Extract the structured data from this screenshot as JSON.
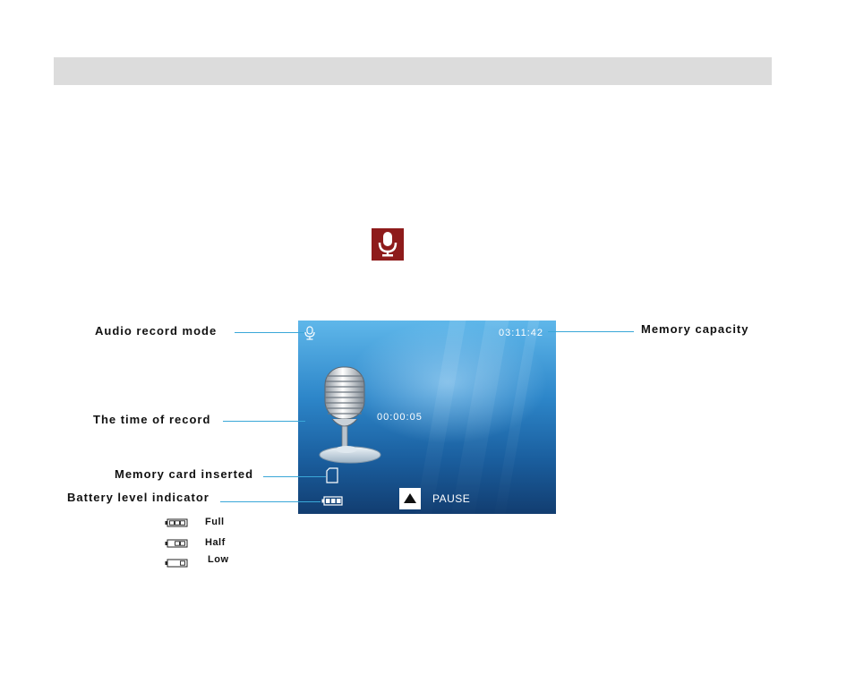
{
  "callouts": {
    "audio_mode": "Audio record mode",
    "record_time": "The time of record",
    "memory_card": "Memory card inserted",
    "battery": "Battery level indicator",
    "memory_capacity": "Memory capacity"
  },
  "screen": {
    "memory_remaining": "03:11:42",
    "record_time": "00:00:05",
    "pause_label": "PAUSE"
  },
  "battery_levels": {
    "full": "Full",
    "half": "Half",
    "low": "Low"
  },
  "icons": {
    "mode": "microphone-icon",
    "card": "sd-card-icon",
    "battery": "battery-icon",
    "pause": "triangle-up-icon"
  },
  "colors": {
    "callout_line": "#3aa7d8",
    "mode_badge": "#8e1b1b",
    "header_bar": "#dcdcdc"
  }
}
